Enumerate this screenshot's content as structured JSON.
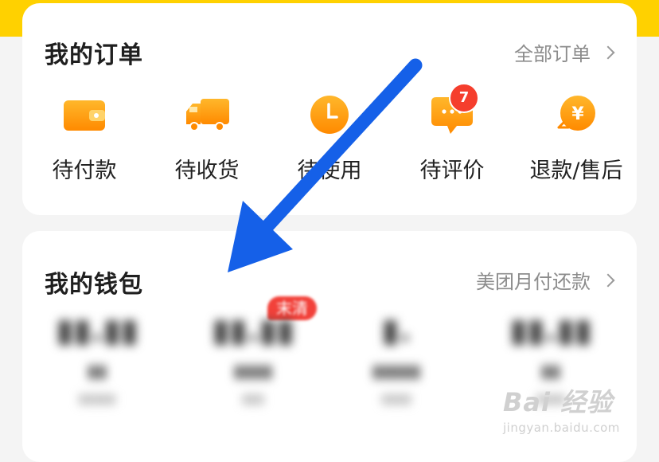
{
  "orders": {
    "title": "我的订单",
    "all_link": "全部订单",
    "items": [
      {
        "label": "待付款",
        "icon": "wallet-icon"
      },
      {
        "label": "待收货",
        "icon": "truck-icon"
      },
      {
        "label": "待使用",
        "icon": "clock-icon"
      },
      {
        "label": "待评价",
        "icon": "chat-icon",
        "badge": "7"
      },
      {
        "label": "退款/售后",
        "icon": "yen-refund-icon"
      }
    ]
  },
  "wallet": {
    "title": "我的钱包",
    "link": "美团月付还款",
    "tag": "末清"
  },
  "watermark": {
    "main": "Bai 经验",
    "sub": "jingyan.baidu.com"
  },
  "colors": {
    "brand_yellow": "#ffd100",
    "icon_orange": "#ff9f0a",
    "badge_red": "#f53e2d",
    "arrow_blue": "#1560e8"
  }
}
